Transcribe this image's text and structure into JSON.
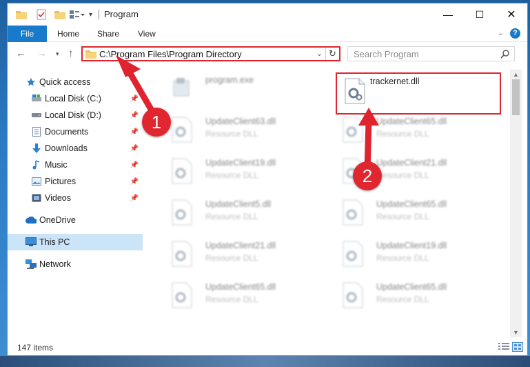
{
  "window": {
    "title": "Program",
    "controls": {
      "minimize": "—",
      "maximize": "☐",
      "close": "✕"
    }
  },
  "ribbon": {
    "tabs": [
      {
        "label": "File"
      },
      {
        "label": "Home"
      },
      {
        "label": "Share"
      },
      {
        "label": "View"
      }
    ],
    "help": "?"
  },
  "address": {
    "path": "C:\\Program Files\\Program Directory",
    "search_placeholder": "Search Program"
  },
  "sidebar": {
    "items": [
      {
        "label": "Quick access",
        "icon": "star-icon"
      },
      {
        "label": "Local Disk (C:)",
        "icon": "drive-icon",
        "pinned": true
      },
      {
        "label": "Local Disk (D:)",
        "icon": "drive-icon",
        "pinned": true
      },
      {
        "label": "Documents",
        "icon": "documents-icon",
        "pinned": true
      },
      {
        "label": "Downloads",
        "icon": "download-icon",
        "pinned": true
      },
      {
        "label": "Music",
        "icon": "music-icon",
        "pinned": true
      },
      {
        "label": "Pictures",
        "icon": "pictures-icon",
        "pinned": true
      },
      {
        "label": "Videos",
        "icon": "videos-icon",
        "pinned": true
      },
      {
        "label": "OneDrive",
        "icon": "cloud-icon"
      },
      {
        "label": "This PC",
        "icon": "computer-icon",
        "selected": true
      },
      {
        "label": "Network",
        "icon": "network-icon"
      }
    ]
  },
  "files": [
    {
      "name": "program.exe",
      "type": ""
    },
    {
      "name": "trackernet.dll",
      "type": ""
    },
    {
      "name": "UpdateClient63.dll",
      "type": "Resource DLL"
    },
    {
      "name": "UpdateClient65.dll",
      "type": "Resource DLL"
    },
    {
      "name": "UpdateClient19.dll",
      "type": "Resource DLL"
    },
    {
      "name": "UpdateClient21.dll",
      "type": "Resource DLL"
    },
    {
      "name": "UpdateClient5.dll",
      "type": "Resource DLL"
    },
    {
      "name": "UpdateClient65.dll",
      "type": "Resource DLL"
    },
    {
      "name": "UpdateClient21.dll",
      "type": "Resource DLL"
    },
    {
      "name": "UpdateClient19.dll",
      "type": "Resource DLL"
    },
    {
      "name": "UpdateClient65.dll",
      "type": "Resource DLL"
    },
    {
      "name": "UpdateClient65.dll",
      "type": "Resource DLL"
    }
  ],
  "status": {
    "item_count": "147 items"
  },
  "annotations": {
    "step1": "1",
    "step2": "2"
  },
  "colors": {
    "accent": "#1979ca",
    "annotation": "#e0242f",
    "selection": "#cce4f7"
  }
}
